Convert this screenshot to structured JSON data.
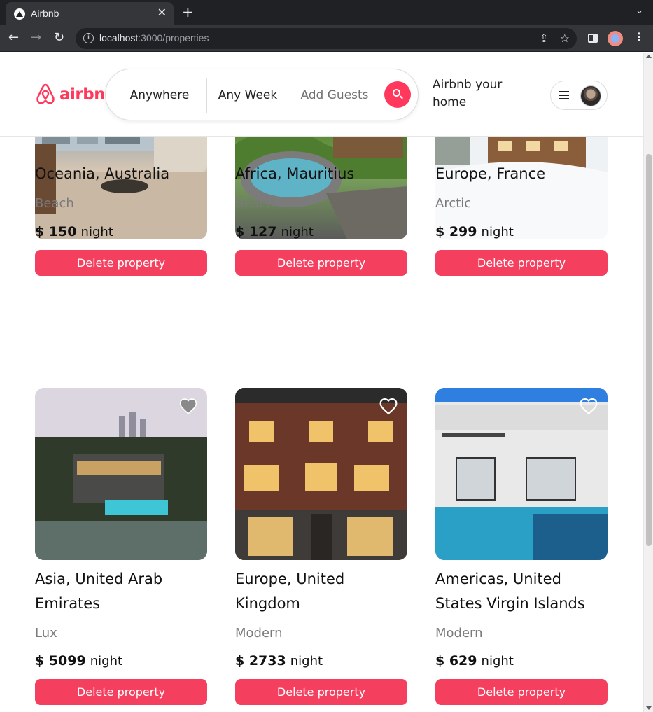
{
  "browser": {
    "tab_title": "Airbnb",
    "tab_close": "✕",
    "new_tab": "+",
    "tabs_menu": "⌄",
    "url_host": "localhost",
    "url_path": ":3000/properties",
    "back": "←",
    "forward": "→",
    "reload": "↻",
    "share": "⇪",
    "star": "☆",
    "menu": "⋮"
  },
  "header": {
    "logo_text": "airbnb",
    "search": {
      "anywhere": "Anywhere",
      "week": "Any Week",
      "guests": "Add Guests"
    },
    "host_link": "Airbnb your home"
  },
  "properties": [
    {
      "title": "Oceania, Australia",
      "type": "Beach",
      "price": "$ 150",
      "unit": "night",
      "delete_label": "Delete property",
      "image": "living-room"
    },
    {
      "title": "Africa, Mauritius",
      "type": "Beach",
      "price": "$ 127",
      "unit": "night",
      "delete_label": "Delete property",
      "image": "jungle-pool"
    },
    {
      "title": "Europe, France",
      "type": "Arctic",
      "price": "$ 299",
      "unit": "night",
      "delete_label": "Delete property",
      "image": "snow-chalet"
    },
    {
      "title": "Asia, United Arab Emirates",
      "type": "Lux",
      "price": "$ 5099",
      "unit": "night",
      "delete_label": "Delete property",
      "image": "luxury-villa",
      "favorited": true
    },
    {
      "title": "Europe, United Kingdom",
      "type": "Modern",
      "price": "$ 2733",
      "unit": "night",
      "delete_label": "Delete property",
      "image": "brick-mansion",
      "favorited": false
    },
    {
      "title": "Americas, United States Virgin Islands",
      "type": "Modern",
      "price": "$ 629",
      "unit": "night",
      "delete_label": "Delete property",
      "image": "modern-pool-house",
      "favorited": false
    }
  ],
  "colors": {
    "brand": "#ff385c",
    "delete_button": "#f43f5e"
  }
}
